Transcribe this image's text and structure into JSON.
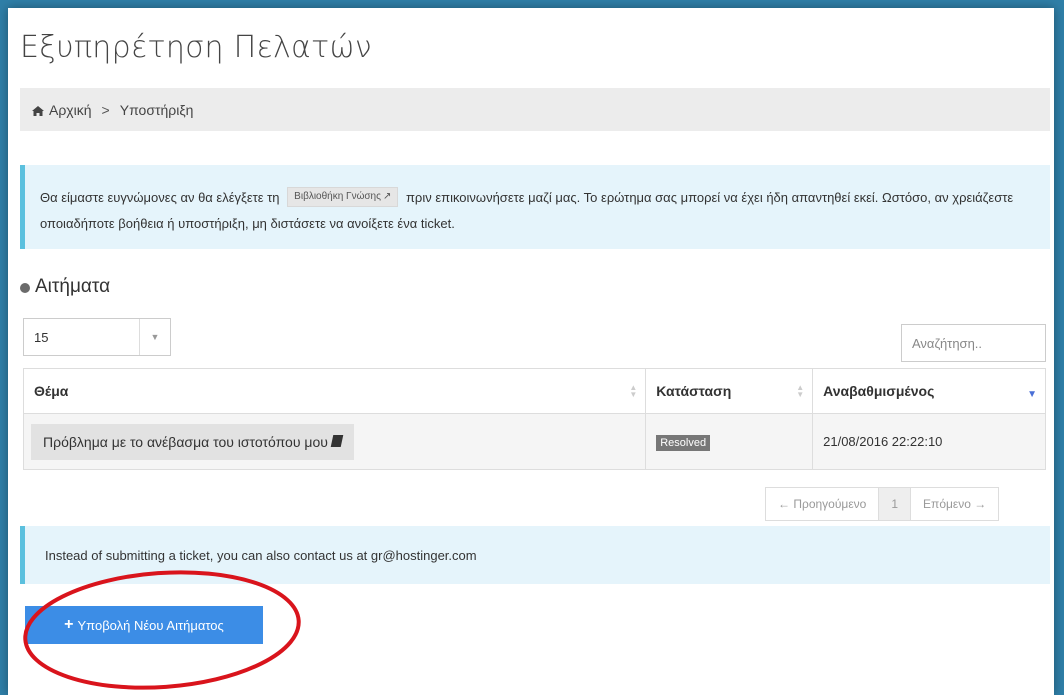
{
  "header": {
    "title": "Εξυπηρέτηση Πελατών"
  },
  "breadcrumb": {
    "home_icon": "home-icon",
    "home": "Αρχική",
    "separator": ">",
    "current": "Υποστήριξη"
  },
  "info": {
    "text_before": "Θα είμαστε ευγνώμονες αν θα ελέγξετε τη",
    "kb_link": "Βιβλιοθήκη Γνώσης",
    "kb_icon": "external-link-icon",
    "text_after": "πριν επικοινωνήσετε μαζί μας. Το ερώτημα σας μπορεί να έχει ήδη απαντηθεί εκεί. Ωστόσο, αν χρειάζεστε οποιαδήποτε βοήθεια ή υποστήριξη, μη διστάσετε να ανοίξετε ένα ticket."
  },
  "tickets": {
    "title": "Αιτήματα",
    "page_size": "15",
    "search_placeholder": "Αναζήτηση..",
    "columns": [
      "Θέμα",
      "Κατάσταση",
      "Αναβαθμισμένος"
    ],
    "rows": [
      {
        "subject": "Πρόβλημα με το ανέβασμα του ιστοτόπου μου",
        "status": "Resolved",
        "updated": "21/08/2016 22:22:10"
      }
    ],
    "pagination": {
      "prev": "← Προηγούμενο",
      "current": "1",
      "next": "Επόμενο →"
    }
  },
  "contact": {
    "text": "Instead of submitting a ticket, you can also contact us at gr@hostinger.com"
  },
  "actions": {
    "submit_label": "Υποβολή Νέου Αιτήματος",
    "submit_icon": "plus-icon"
  },
  "colors": {
    "accent": "#3c8de6",
    "info_border": "#5bc0de",
    "info_bg": "#e5f4fb",
    "annotation": "#d9141c"
  }
}
